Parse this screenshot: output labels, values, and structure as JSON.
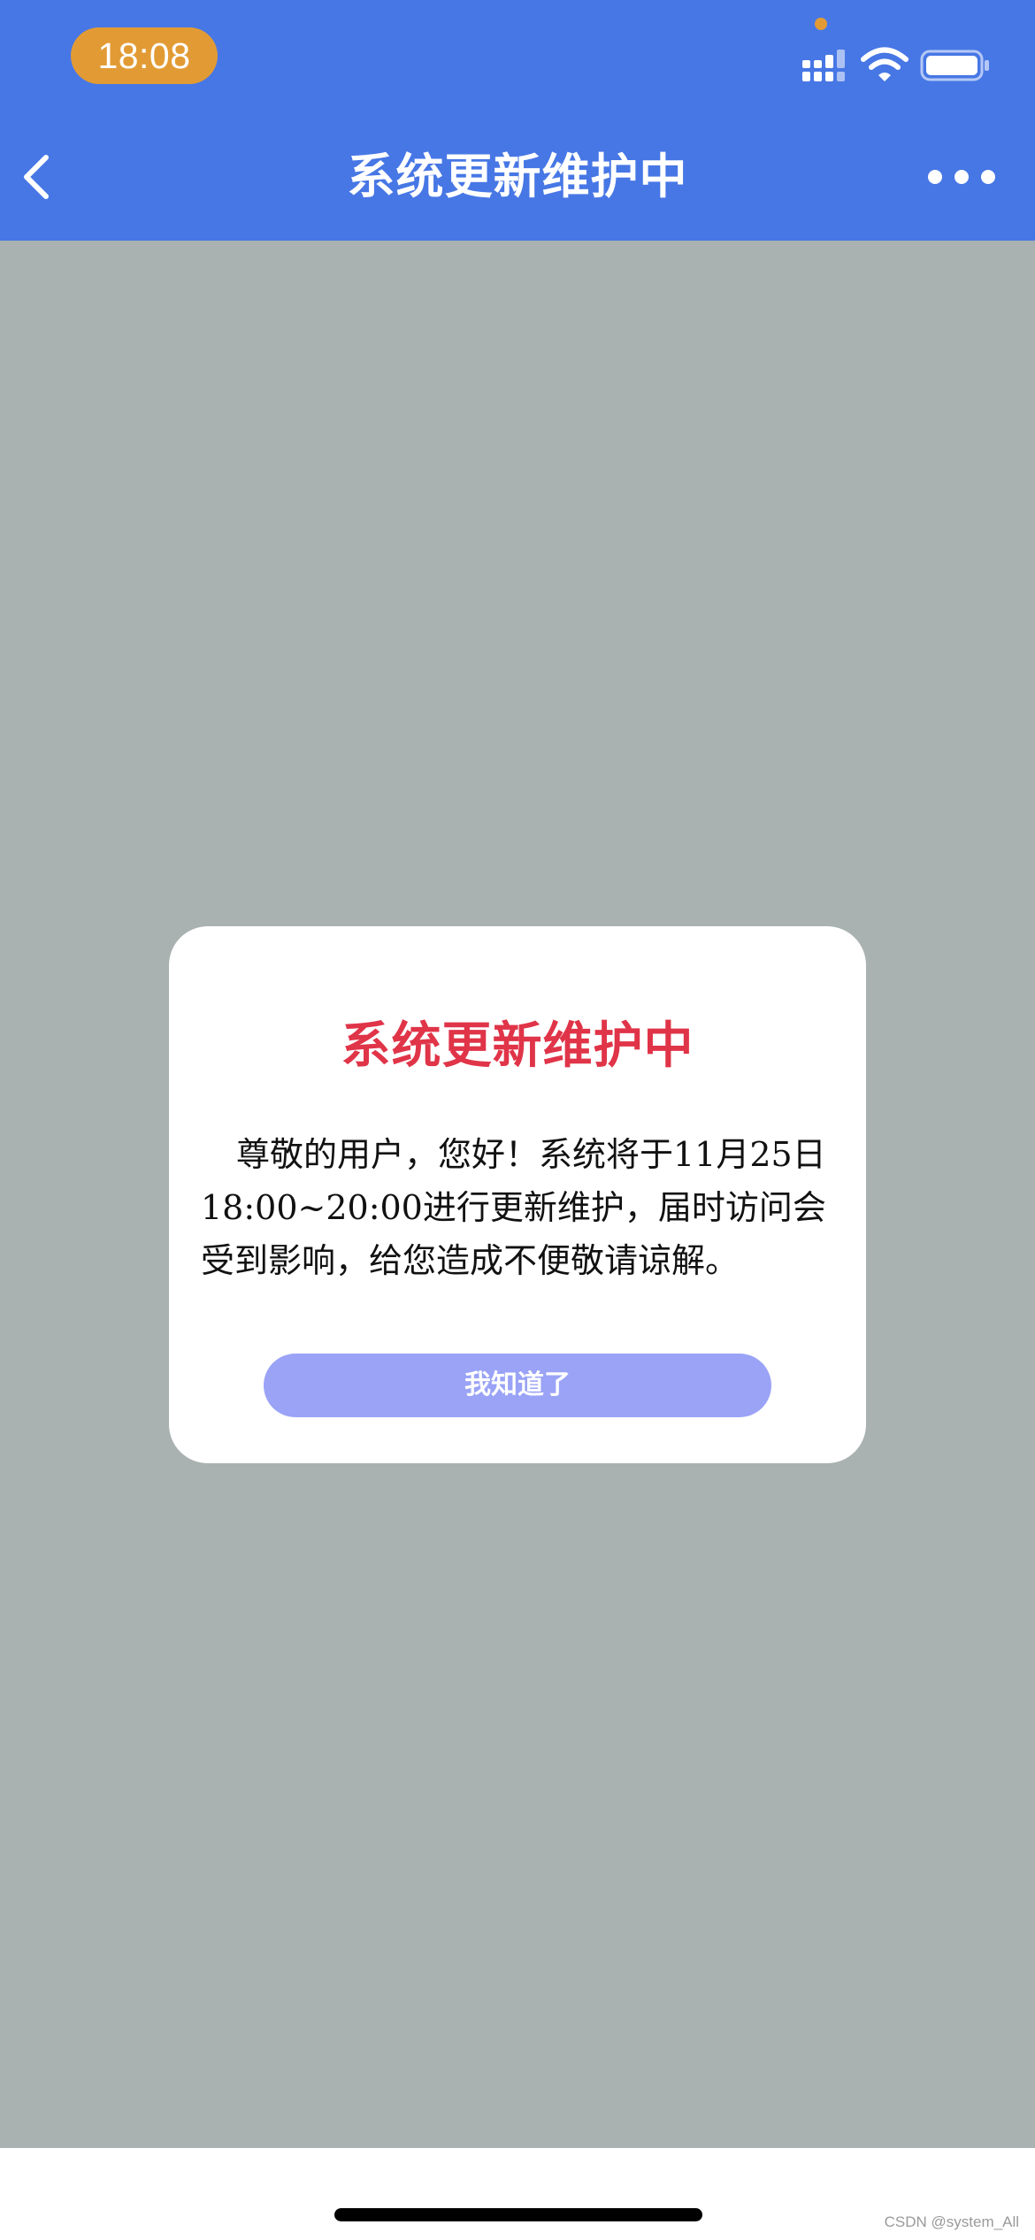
{
  "status_bar": {
    "time": "18:08",
    "signal_icon": "cellular-signal-icon",
    "wifi_icon": "wifi-icon",
    "battery_icon": "battery-icon",
    "accent_color": "#e29b34"
  },
  "nav": {
    "title": "系统更新维护中",
    "back_icon": "chevron-left-icon",
    "more_icon": "more-dots-icon",
    "background_color": "#4777e5"
  },
  "dialog": {
    "title": "系统更新维护中",
    "message": "尊敬的用户，您好！系统将于11月25日18:00~20:00进行更新维护，届时访问会受到影响，给您造成不便敬请谅解。",
    "button_label": "我知道了",
    "title_color": "#e03448",
    "button_color": "#9aa3f6"
  },
  "footer": {
    "watermark": "CSDN @system_All"
  }
}
